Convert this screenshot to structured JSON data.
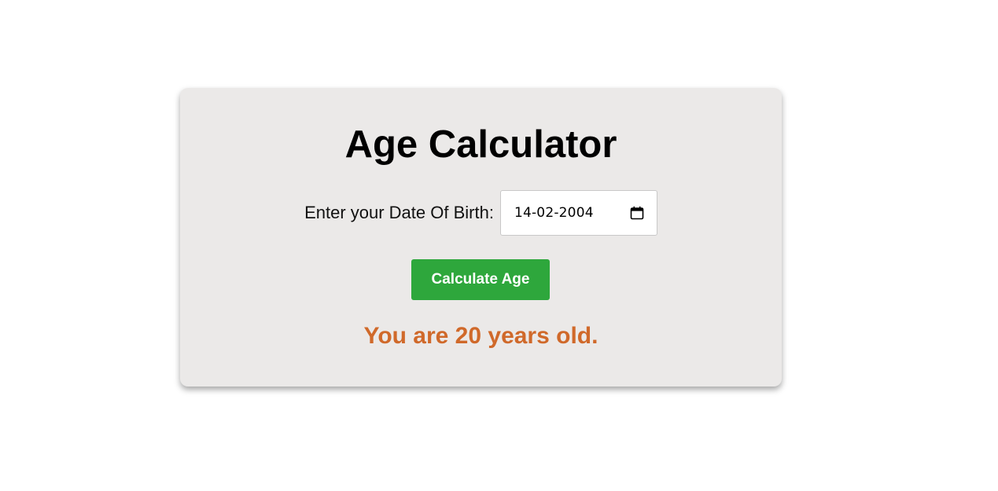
{
  "app": {
    "title": "Age Calculator"
  },
  "form": {
    "dob_label": "Enter your Date Of Birth:",
    "dob_value": "14-02-2004",
    "calendar_icon": "calendar-icon",
    "calculate_label": "Calculate Age"
  },
  "result": {
    "text": "You are 20 years old."
  },
  "colors": {
    "card_background": "#ebe9e8",
    "button": "#2ea73c",
    "result_text": "#d0692a"
  }
}
